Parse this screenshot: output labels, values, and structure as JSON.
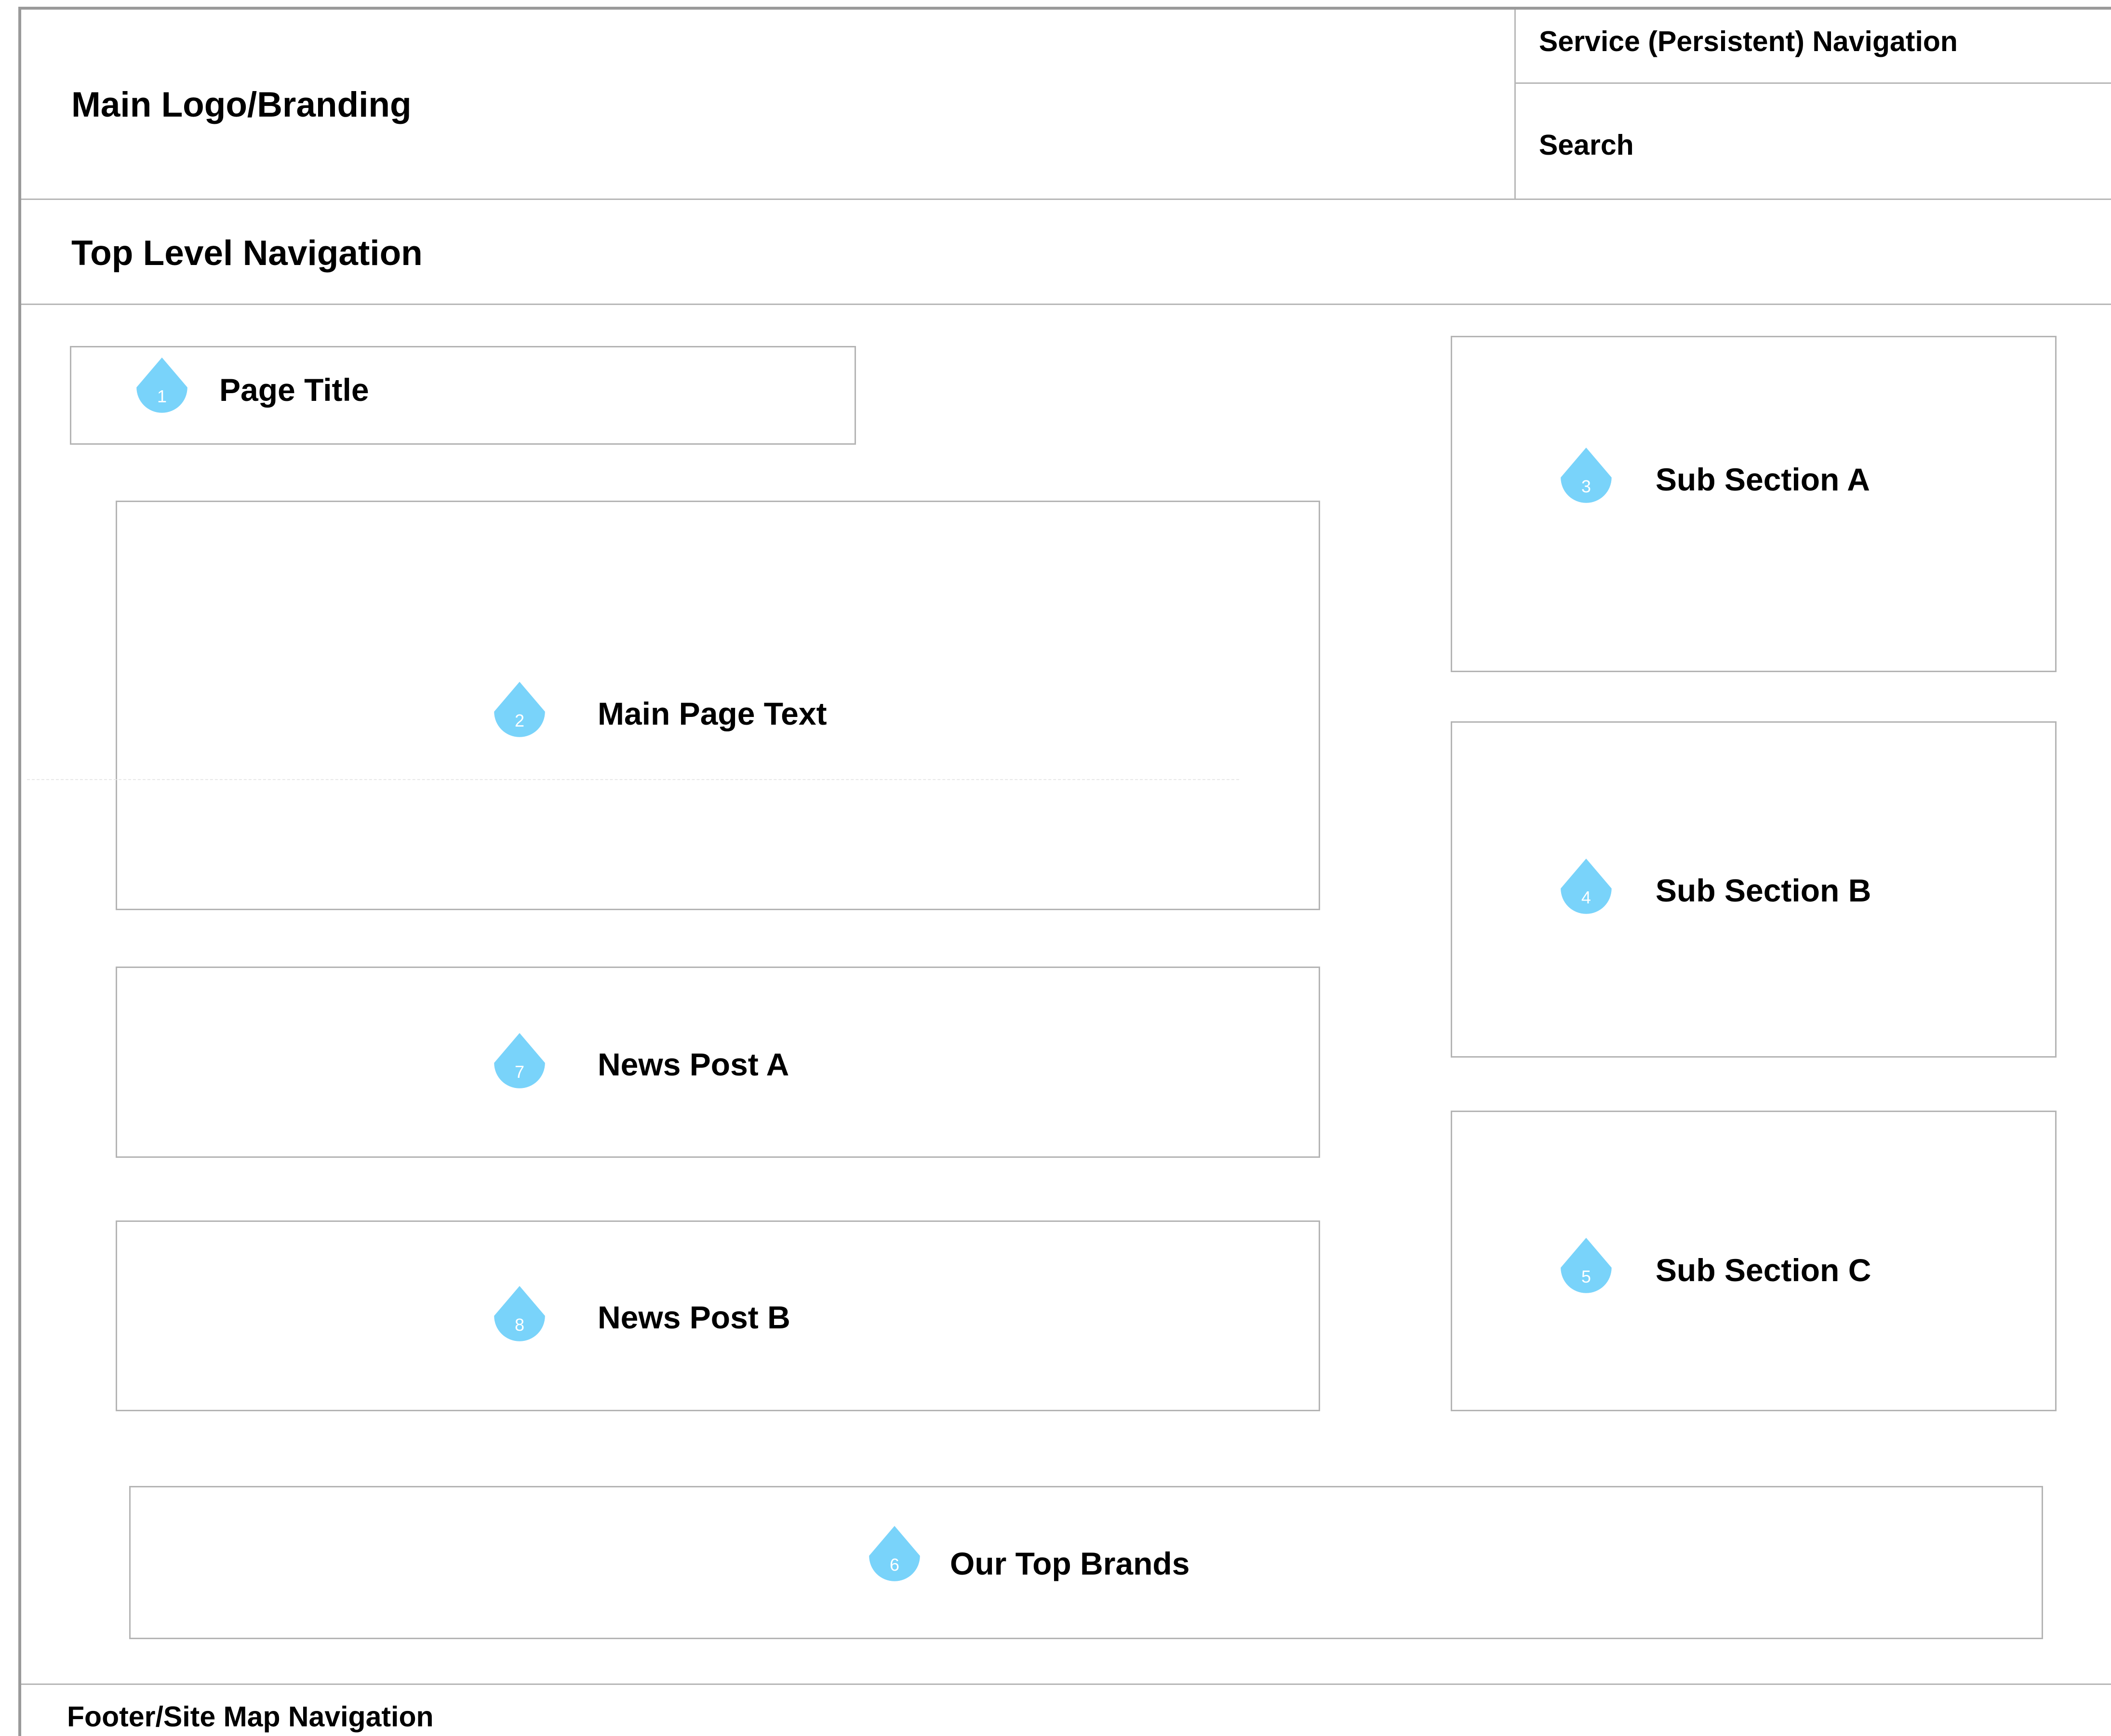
{
  "header": {
    "logo": "Main Logo/Branding",
    "service_nav": "Service (Persistent) Navigation",
    "search": "Search"
  },
  "top_nav": "Top Level Navigation",
  "page_title": {
    "marker": "1",
    "label": "Page Title"
  },
  "main_text": {
    "marker": "2",
    "label": "Main Page Text"
  },
  "sub_sections": [
    {
      "marker": "3",
      "label": "Sub Section A"
    },
    {
      "marker": "4",
      "label": "Sub Section B"
    },
    {
      "marker": "5",
      "label": "Sub Section C"
    }
  ],
  "news_posts": [
    {
      "marker": "7",
      "label": "News Post A"
    },
    {
      "marker": "8",
      "label": "News Post B"
    }
  ],
  "top_brands": {
    "marker": "6",
    "label": "Our Top Brands"
  },
  "footer": "Footer/Site Map Navigation",
  "colors": {
    "marker_fill": "#79d3fa",
    "border": "#b4b4b4",
    "frame": "#9a9a9a"
  }
}
